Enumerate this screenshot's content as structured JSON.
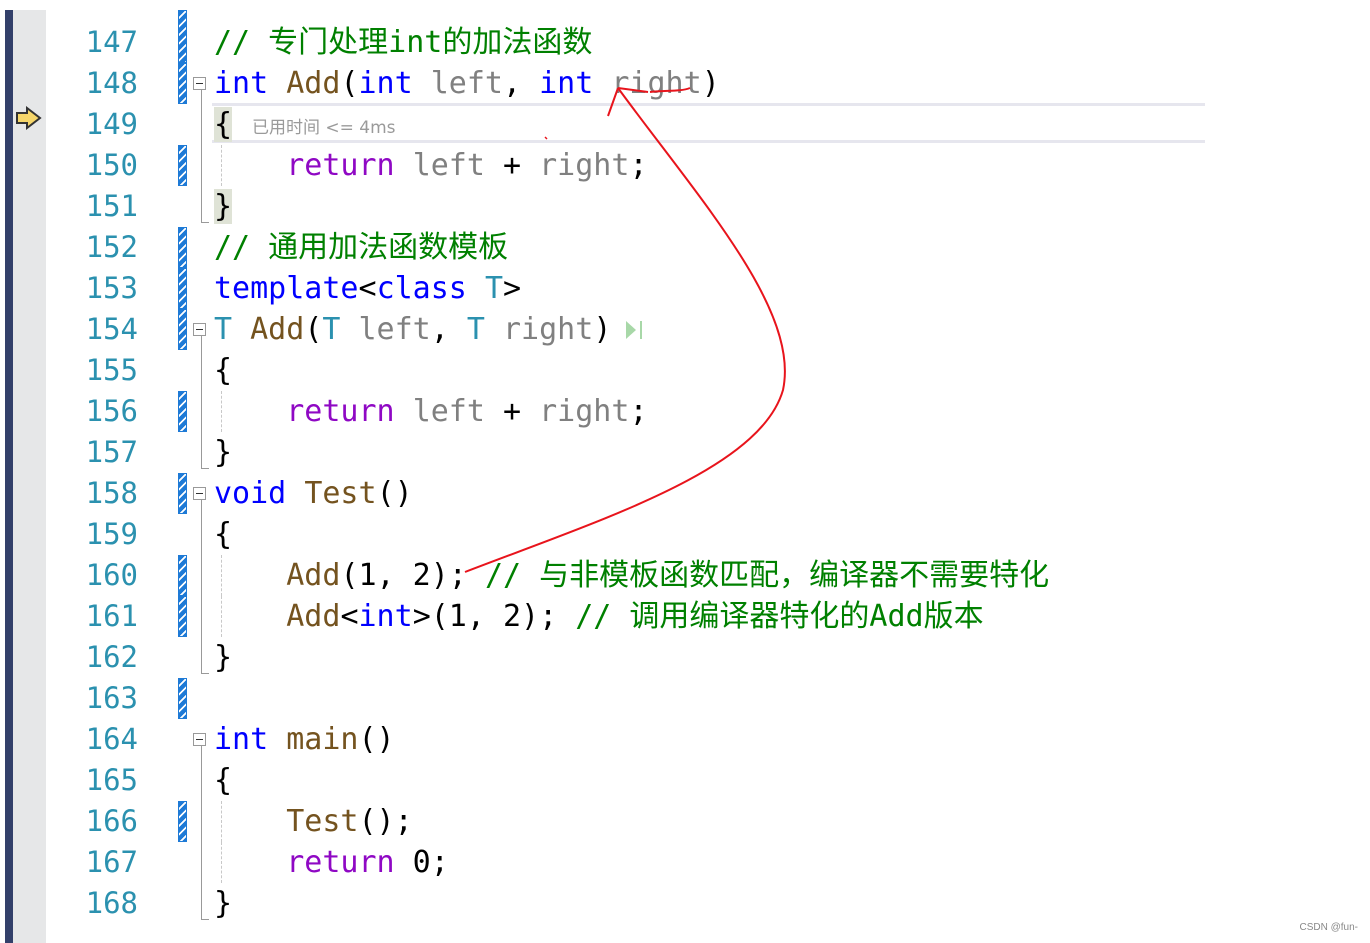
{
  "editor": {
    "current_line": 149,
    "perf_tip": "已用时间 <= 4ms",
    "lines": [
      {
        "n": "147",
        "chg": true,
        "tokens": [
          [
            "// 专门处理int的加法函数",
            "cm"
          ]
        ]
      },
      {
        "n": "148",
        "chg": true,
        "fold": true,
        "tokens": [
          [
            "int",
            "kw"
          ],
          [
            " ",
            ""
          ],
          [
            "Add",
            "fn"
          ],
          [
            "(",
            ""
          ],
          [
            "int",
            "kw"
          ],
          [
            " ",
            ""
          ],
          [
            "left",
            "pm"
          ],
          [
            ", ",
            ""
          ],
          [
            "int",
            "kw"
          ],
          [
            " ",
            ""
          ],
          [
            "right",
            "pm"
          ],
          [
            ")",
            ""
          ]
        ]
      },
      {
        "n": "149",
        "tokens": [
          [
            "{",
            "brhl"
          ]
        ]
      },
      {
        "n": "150",
        "chg": true,
        "tokens": [
          [
            "    ",
            ""
          ],
          [
            "return",
            "ctl"
          ],
          [
            " ",
            ""
          ],
          [
            "left",
            "pm"
          ],
          [
            " + ",
            ""
          ],
          [
            "right",
            "pm"
          ],
          [
            ";",
            ""
          ]
        ]
      },
      {
        "n": "151",
        "tokens": [
          [
            "}",
            "brhl"
          ]
        ]
      },
      {
        "n": "152",
        "chg": true,
        "tokens": [
          [
            "// 通用加法函数模板",
            "cm"
          ]
        ]
      },
      {
        "n": "153",
        "chg": true,
        "tokens": [
          [
            "template",
            "kw"
          ],
          [
            "<",
            ""
          ],
          [
            "class",
            "kw"
          ],
          [
            " ",
            ""
          ],
          [
            "T",
            "ty"
          ],
          [
            ">",
            ""
          ]
        ]
      },
      {
        "n": "154",
        "chg": true,
        "fold": true,
        "tokens": [
          [
            "T",
            "ty"
          ],
          [
            " ",
            ""
          ],
          [
            "Add",
            "fn"
          ],
          [
            "(",
            ""
          ],
          [
            "T",
            "ty"
          ],
          [
            " ",
            ""
          ],
          [
            "left",
            "pm"
          ],
          [
            ", ",
            ""
          ],
          [
            "T",
            "ty"
          ],
          [
            " ",
            ""
          ],
          [
            "right",
            "pm"
          ],
          [
            ")",
            ""
          ]
        ]
      },
      {
        "n": "155",
        "tokens": [
          [
            "{",
            ""
          ]
        ]
      },
      {
        "n": "156",
        "chg": true,
        "tokens": [
          [
            "    ",
            ""
          ],
          [
            "return",
            "ctl"
          ],
          [
            " ",
            ""
          ],
          [
            "left",
            "pm"
          ],
          [
            " + ",
            ""
          ],
          [
            "right",
            "pm"
          ],
          [
            ";",
            ""
          ]
        ]
      },
      {
        "n": "157",
        "tokens": [
          [
            "}",
            ""
          ]
        ]
      },
      {
        "n": "158",
        "chg": true,
        "fold": true,
        "tokens": [
          [
            "void",
            "kw"
          ],
          [
            " ",
            ""
          ],
          [
            "Test",
            "fn"
          ],
          [
            "()",
            ""
          ]
        ]
      },
      {
        "n": "159",
        "tokens": [
          [
            "{",
            ""
          ]
        ]
      },
      {
        "n": "160",
        "chg": true,
        "tokens": [
          [
            "    ",
            ""
          ],
          [
            "Add",
            "fn"
          ],
          [
            "(1, 2); ",
            ""
          ],
          [
            "// 与非模板函数匹配，编译器不需要特化",
            "cm"
          ]
        ]
      },
      {
        "n": "161",
        "chg": true,
        "tokens": [
          [
            "    ",
            ""
          ],
          [
            "Add",
            "fn"
          ],
          [
            "<",
            ""
          ],
          [
            "int",
            "kw"
          ],
          [
            ">(1, 2); ",
            ""
          ],
          [
            "// 调用编译器特化的Add版本",
            "cm"
          ]
        ]
      },
      {
        "n": "162",
        "tokens": [
          [
            "}",
            ""
          ]
        ]
      },
      {
        "n": "163",
        "chg": true,
        "tokens": []
      },
      {
        "n": "164",
        "fold": true,
        "tokens": [
          [
            "int",
            "kw"
          ],
          [
            " ",
            ""
          ],
          [
            "main",
            "fn"
          ],
          [
            "()",
            ""
          ]
        ]
      },
      {
        "n": "165",
        "tokens": [
          [
            "{",
            ""
          ]
        ]
      },
      {
        "n": "166",
        "chg": true,
        "tokens": [
          [
            "    ",
            ""
          ],
          [
            "Test",
            "fn"
          ],
          [
            "();",
            ""
          ]
        ]
      },
      {
        "n": "167",
        "tokens": [
          [
            "    ",
            ""
          ],
          [
            "return",
            "ctl"
          ],
          [
            " 0;",
            ""
          ]
        ]
      },
      {
        "n": "168",
        "tokens": [
          [
            "}",
            ""
          ]
        ]
      }
    ]
  },
  "colors": {
    "annotation": "#e8141c",
    "line_number": "#2b91af",
    "keyword": "#0000ff",
    "comment": "#008000"
  },
  "watermark": "CSDN @fun-"
}
